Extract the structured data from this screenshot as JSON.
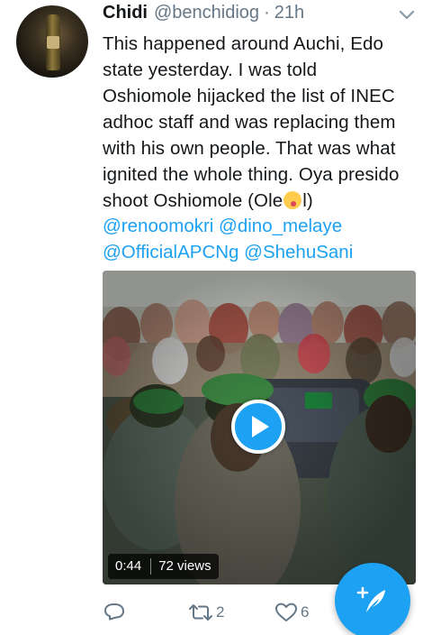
{
  "tweet": {
    "author_name": "Chidi",
    "author_handle": "@benchidiog",
    "separator": "·",
    "time": "21h",
    "text_lines": [
      "This happened around Auchi, Edo",
      "state yesterday. I was told",
      "Oshiomole hijacked the list of INEC",
      "adhoc staff and was replacing them",
      "with his own people. That was what",
      "ignited the whole thing. Oya presido"
    ],
    "last_line_before_emoji": "shoot Oshiomole (Ole",
    "emoji_name": "zany-face-emoji",
    "last_line_after_emoji": "l)",
    "mention_lines": [
      "@renoomokri @dino_melaye",
      "@OfficialAPCNg @ShehuSani"
    ]
  },
  "video": {
    "duration": "0:44",
    "views": "72 views",
    "play_icon": "play-icon"
  },
  "actions": {
    "reply_icon": "reply-icon",
    "retweet_icon": "retweet-icon",
    "retweet_count": "2",
    "like_icon": "heart-icon",
    "like_count": "6"
  },
  "fab": {
    "icon": "compose-tweet-icon"
  },
  "colors": {
    "accent": "#1da1f2",
    "text": "#14171a",
    "secondary": "#657786"
  }
}
